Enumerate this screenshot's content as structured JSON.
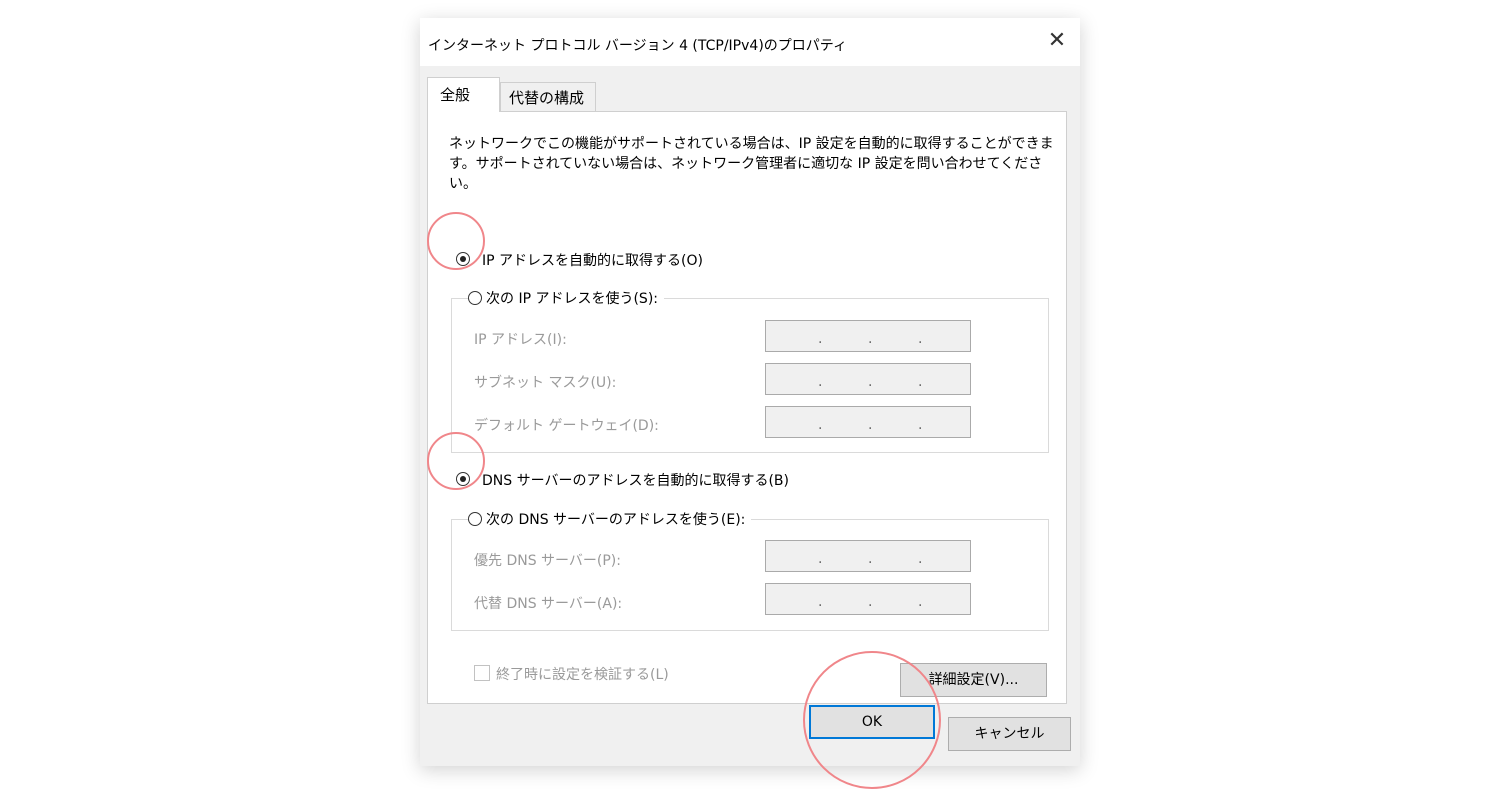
{
  "dialog": {
    "title": "インターネット プロトコル バージョン 4 (TCP/IPv4)のプロパティ",
    "close_glyph": "✕"
  },
  "tabs": [
    "全般",
    "代替の構成"
  ],
  "description": "ネットワークでこの機能がサポートされている場合は、IP 設定を自動的に取得することができます。サポートされていない場合は、ネットワーク管理者に適切な IP 設定を問い合わせてください。",
  "ip": {
    "auto_label": "IP アドレスを自動的に取得する(O)",
    "manual_label": "次の IP アドレスを使う(S):",
    "selected": "auto",
    "fields": [
      {
        "label": "IP アドレス(I):",
        "value": ". . ."
      },
      {
        "label": "サブネット マスク(U):",
        "value": ". . ."
      },
      {
        "label": "デフォルト ゲートウェイ(D):",
        "value": ". . ."
      }
    ]
  },
  "dns": {
    "auto_label": "DNS サーバーのアドレスを自動的に取得する(B)",
    "manual_label": "次の DNS サーバーのアドレスを使う(E):",
    "selected": "auto",
    "fields": [
      {
        "label": "優先 DNS サーバー(P):",
        "value": ". . ."
      },
      {
        "label": "代替 DNS サーバー(A):",
        "value": ". . ."
      }
    ]
  },
  "validate_label": "終了時に設定を検証する(L)",
  "advanced_label": "詳細設定(V)...",
  "ok_label": "OK",
  "cancel_label": "キャンセル",
  "colors": {
    "highlight": "#f0868a",
    "ok_border": "#0078d7"
  }
}
